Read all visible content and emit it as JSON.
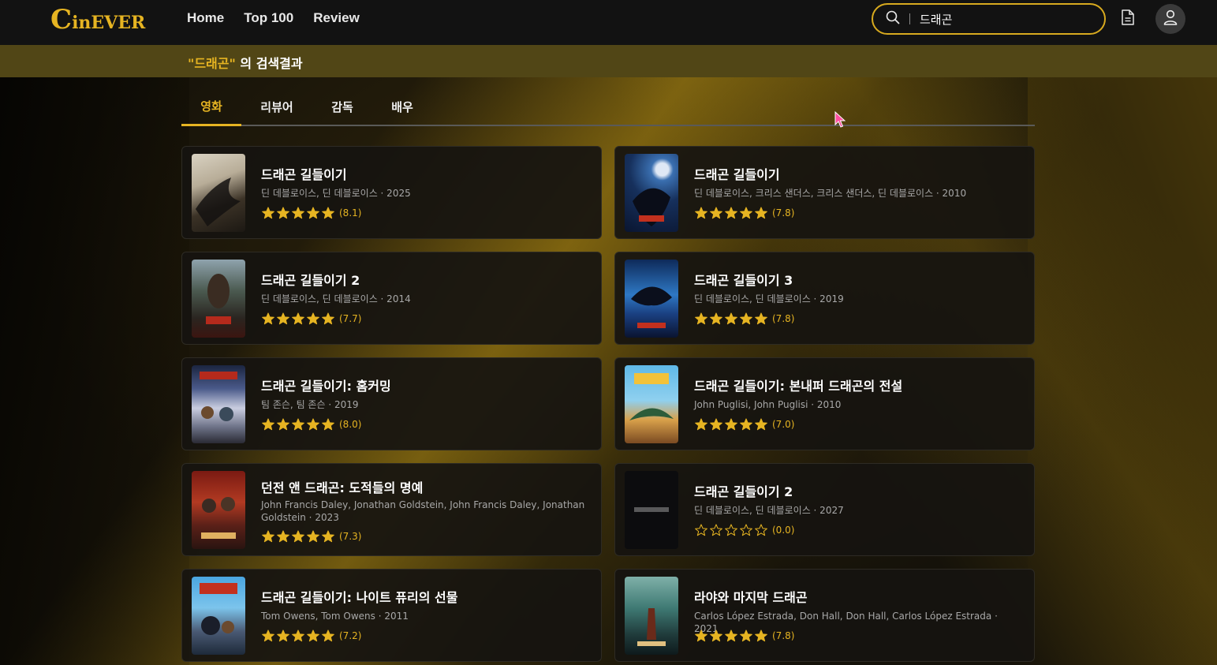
{
  "colors": {
    "accent": "#e6b422",
    "background": "#121212",
    "card": "#161410",
    "result_bar": "#514616"
  },
  "header": {
    "logo_first": "C",
    "logo_rest": "inEVER",
    "nav": [
      "Home",
      "Top 100",
      "Review"
    ],
    "search_value": "드래곤",
    "icons": [
      "search-icon",
      "document-icon",
      "user-icon"
    ]
  },
  "result": {
    "keyword": "\"드래곤\"",
    "suffix": " 의 검색결과"
  },
  "tabs": [
    "영화",
    "리뷰어",
    "감독",
    "배우"
  ],
  "active_tab": "영화",
  "movies": [
    {
      "title": "드래곤 길들이기",
      "meta": "딘 데블로이스, 딘 데블로이스 · 2025",
      "score": "(8.1)",
      "stars": 5
    },
    {
      "title": "드래곤 길들이기",
      "meta": "딘 데블로이스, 크리스 샌더스, 크리스 샌더스, 딘 데블로이스 · 2010",
      "score": "(7.8)",
      "stars": 5
    },
    {
      "title": "드래곤 길들이기 2",
      "meta": "딘 데블로이스, 딘 데블로이스 · 2014",
      "score": "(7.7)",
      "stars": 5
    },
    {
      "title": "드래곤 길들이기 3",
      "meta": "딘 데블로이스, 딘 데블로이스 · 2019",
      "score": "(7.8)",
      "stars": 5
    },
    {
      "title": "드래곤 길들이기: 홈커밍",
      "meta": "팀 존슨, 팀 존슨 · 2019",
      "score": "(8.0)",
      "stars": 5
    },
    {
      "title": "드래곤 길들이기: 본내퍼 드래곤의 전설",
      "meta": "John Puglisi, John Puglisi · 2010",
      "score": "(7.0)",
      "stars": 5
    },
    {
      "title": "던전 앤 드래곤: 도적들의 명예",
      "meta": "John Francis Daley, Jonathan Goldstein, John Francis Daley, Jonathan Goldstein · 2023",
      "score": "(7.3)",
      "stars": 5
    },
    {
      "title": "드래곤 길들이기 2",
      "meta": "딘 데블로이스, 딘 데블로이스 · 2027",
      "score": "(0.0)",
      "stars": 0
    },
    {
      "title": "드래곤 길들이기: 나이트 퓨리의 선물",
      "meta": "Tom Owens, Tom Owens · 2011",
      "score": "(7.2)",
      "stars": 5
    },
    {
      "title": "라야와 마지막 드래곤",
      "meta": "Carlos López Estrada, Don Hall, Don Hall, Carlos López Estrada · 2021",
      "score": "(7.8)",
      "stars": 5
    }
  ]
}
